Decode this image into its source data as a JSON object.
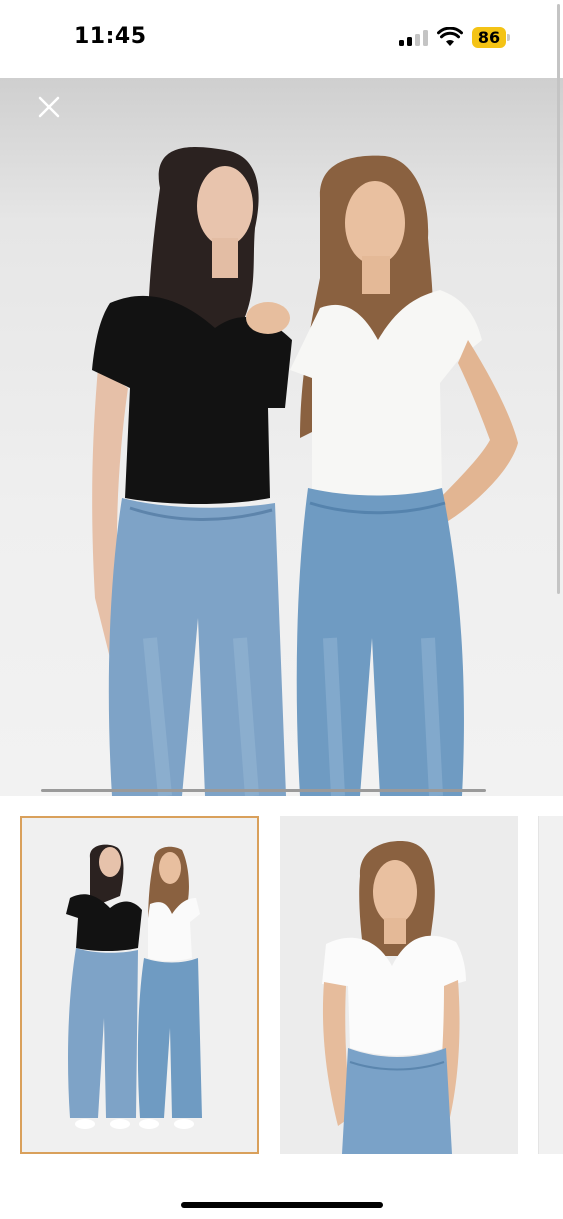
{
  "status_bar": {
    "time": "11:45",
    "battery_level": "86",
    "battery_color": "#f4c315",
    "icons": [
      "cellular-signal-icon",
      "wifi-icon",
      "battery-icon"
    ]
  },
  "gallery": {
    "close_icon": "close-icon",
    "selected_thumbnail": 1,
    "accent_color": "#d9a05b",
    "images": [
      {
        "description_icon": "product-photo-two-models"
      },
      {
        "description_icon": "product-photo-single-model"
      },
      {
        "description_icon": "product-photo-partial"
      }
    ]
  }
}
